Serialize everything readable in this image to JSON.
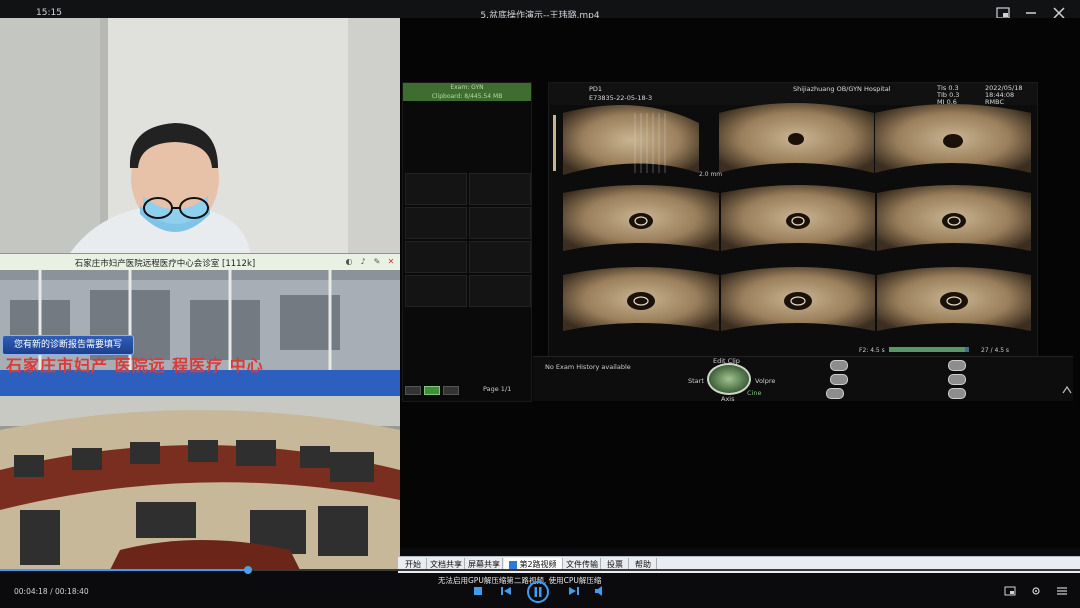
{
  "window": {
    "clock": "15:15",
    "title": "5.盆底操作演示--王玮璐.mp4"
  },
  "video_caption": {
    "text": "石家庄市妇产医院远程医疗中心会诊室 [1112k]"
  },
  "notification": {
    "text": "您有新的诊断报告需要填写"
  },
  "room_sign": {
    "text": "石家庄市妇产 医院远 程医疗 中心"
  },
  "ultrasound": {
    "side_head_line1": "Exam: GYN",
    "side_head_line2": "Clipboard: 8/445.54 MB",
    "header": {
      "probe": "PD1",
      "id": "E73835-22-05-18-3",
      "hospital": "Shijiazhuang OB/GYN Hospital",
      "tis": "TIs  0.3",
      "tib": "TIb  0.3",
      "mi": "MI   0.6",
      "date": "2022/05/18",
      "time": "18:44:08",
      "mode": "RMBC"
    },
    "depth_label": "2.0 mm",
    "page_label": "Page 1/1",
    "footer_left": "F2: 4.5 s",
    "footer_right": "27 / 4.5 s"
  },
  "controls": {
    "history": "No Exam History available",
    "edit_clip": "Edit Clip",
    "start": "Start",
    "volpre": "Volpre",
    "axis": "Axis",
    "cine": "Cine"
  },
  "toolbar": {
    "tabs": [
      "开始",
      "文档共享",
      "屏幕共享",
      "第2路视频",
      "文件传输",
      "投票",
      "帮助"
    ],
    "active_index": 3,
    "gpu_note": "无法启用GPU解压缩第二路视频, 使用CPU解压缩"
  },
  "player": {
    "time_current": "00:04:18",
    "time_total": "00:18:40",
    "progress": 0.23
  },
  "colors": {
    "accent": "#3f9cf0",
    "caption_border": "#6fb34b",
    "notify_bg": "#2f5fb8"
  }
}
